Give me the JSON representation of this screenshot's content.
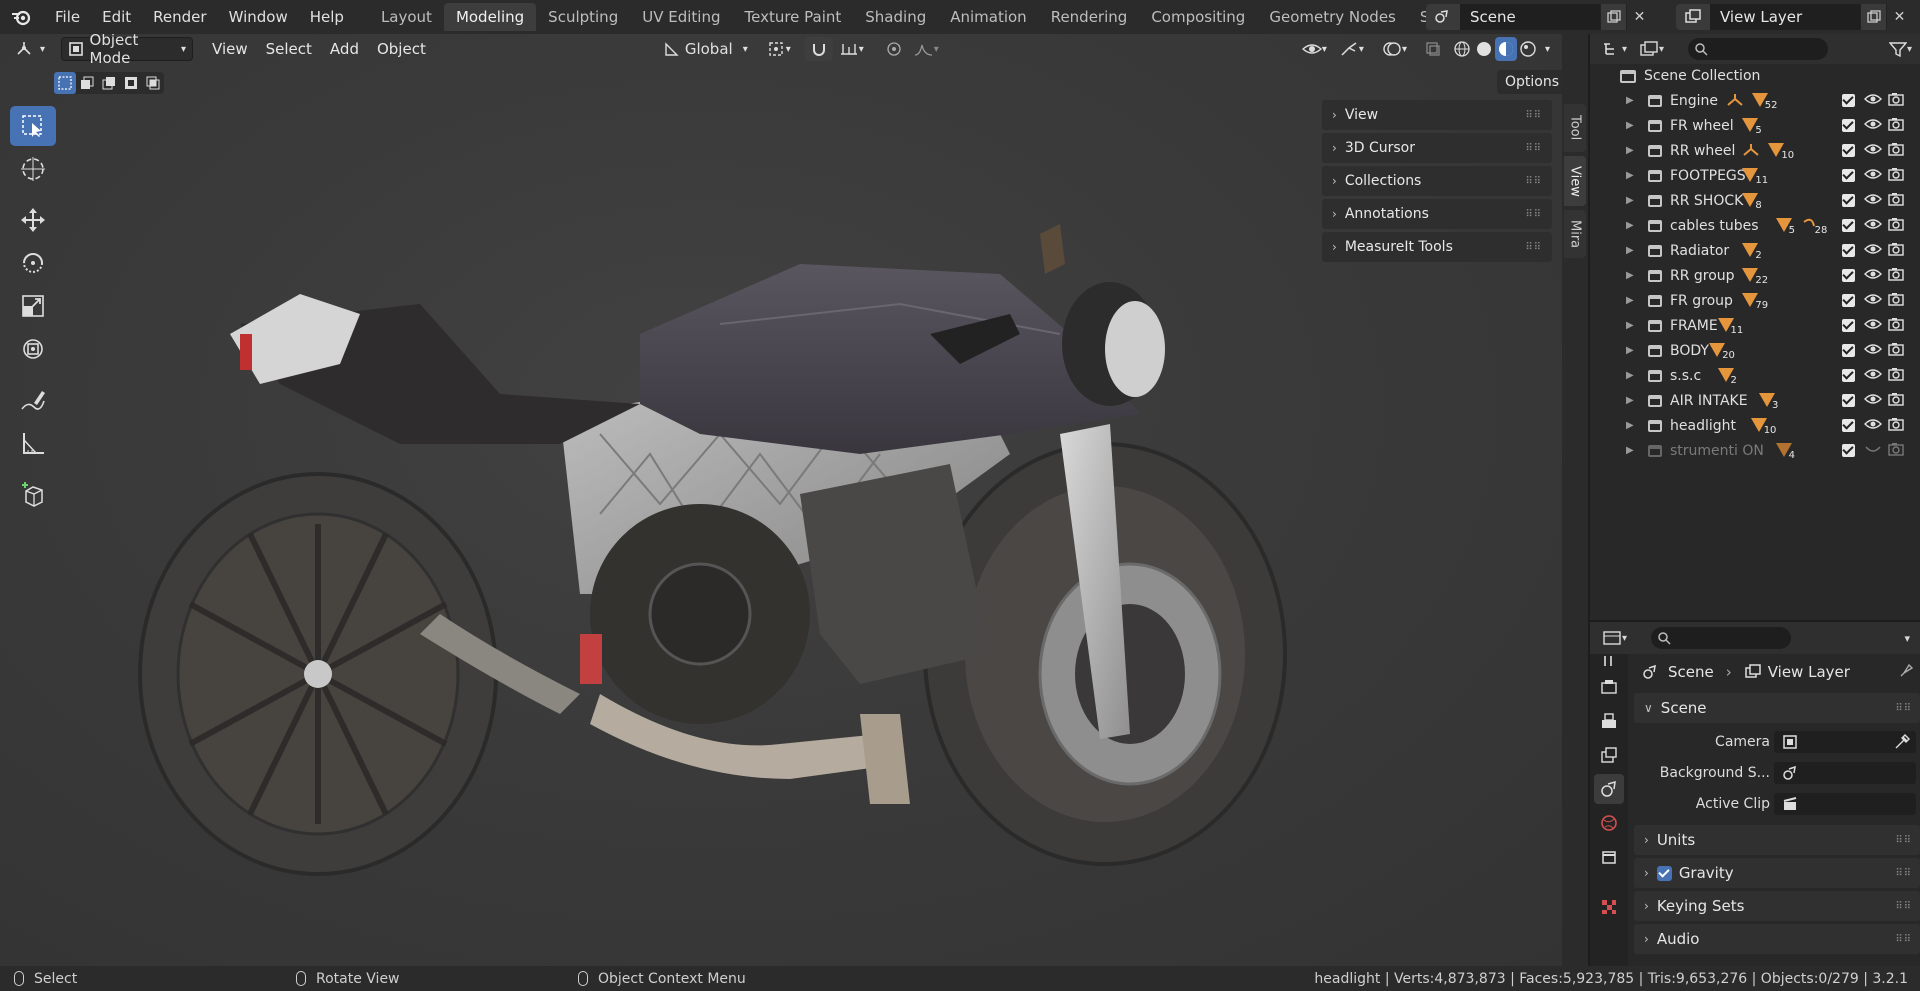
{
  "topbar": {
    "menus": [
      "File",
      "Edit",
      "Render",
      "Window",
      "Help"
    ],
    "workspaces": [
      "Layout",
      "Modeling",
      "Sculpting",
      "UV Editing",
      "Texture Paint",
      "Shading",
      "Animation",
      "Rendering",
      "Compositing",
      "Geometry Nodes",
      "Scripting"
    ],
    "active_workspace": "Modeling",
    "add_tab": "+",
    "scene": "Scene",
    "view_layer": "View Layer"
  },
  "viewport": {
    "mode": "Object Mode",
    "menus": [
      "View",
      "Select",
      "Add",
      "Object"
    ],
    "orientation": "Global",
    "options_label": "Options",
    "npanel_items": [
      "View",
      "3D Cursor",
      "Collections",
      "Annotations",
      "MeasureIt Tools"
    ],
    "side_tabs": [
      "Tool",
      "View",
      "Mira"
    ],
    "active_side_tab": "View"
  },
  "outliner": {
    "root": "Scene Collection",
    "collections": [
      {
        "name": "Engine",
        "badges": [
          {
            "type": "bone"
          },
          {
            "type": "mesh",
            "count": "52"
          }
        ],
        "disabled": false
      },
      {
        "name": "FR wheel",
        "badges": [
          {
            "type": "mesh",
            "count": "5"
          }
        ],
        "disabled": false
      },
      {
        "name": "RR wheel",
        "badges": [
          {
            "type": "bone"
          },
          {
            "type": "mesh",
            "count": "10"
          }
        ],
        "disabled": false
      },
      {
        "name": "FOOTPEGS",
        "badges": [
          {
            "type": "mesh",
            "count": "11"
          }
        ],
        "disabled": false
      },
      {
        "name": "RR SHOCK",
        "badges": [
          {
            "type": "mesh",
            "count": "8"
          }
        ],
        "disabled": false
      },
      {
        "name": "cables tubes",
        "badges": [
          {
            "type": "mesh",
            "count": "5"
          },
          {
            "type": "curve",
            "count": "28"
          }
        ],
        "disabled": false
      },
      {
        "name": "Radiator",
        "badges": [
          {
            "type": "mesh",
            "count": "2"
          }
        ],
        "disabled": false
      },
      {
        "name": "RR group",
        "badges": [
          {
            "type": "mesh",
            "count": "22"
          }
        ],
        "disabled": false
      },
      {
        "name": "FR group",
        "badges": [
          {
            "type": "mesh",
            "count": "79"
          }
        ],
        "disabled": false
      },
      {
        "name": "FRAME",
        "badges": [
          {
            "type": "mesh",
            "count": "11"
          }
        ],
        "disabled": false
      },
      {
        "name": "BODY",
        "badges": [
          {
            "type": "mesh",
            "count": "20"
          }
        ],
        "disabled": false
      },
      {
        "name": "s.s.c",
        "badges": [
          {
            "type": "mesh",
            "count": "2"
          }
        ],
        "disabled": false
      },
      {
        "name": "AIR INTAKE",
        "badges": [
          {
            "type": "mesh",
            "count": "3"
          }
        ],
        "disabled": false
      },
      {
        "name": "headlight",
        "badges": [
          {
            "type": "mesh",
            "count": "10"
          }
        ],
        "disabled": false
      },
      {
        "name": "strumenti ON",
        "badges": [
          {
            "type": "mesh",
            "count": "4"
          }
        ],
        "disabled": true
      }
    ]
  },
  "properties": {
    "breadcrumb": [
      "Scene",
      "View Layer"
    ],
    "scene_panel": "Scene",
    "fields": [
      {
        "label": "Camera"
      },
      {
        "label": "Background S..."
      },
      {
        "label": "Active Clip"
      }
    ],
    "panels": [
      "Units",
      "Gravity",
      "Keying Sets",
      "Audio"
    ]
  },
  "statusbar": {
    "select": "Select",
    "rotate": "Rotate View",
    "context": "Object Context Menu",
    "stats": "headlight | Verts:4,873,873 | Faces:5,923,785 | Tris:9,653,276 | Objects:0/279 | 3.2.1"
  },
  "colors": {
    "accent": "#4772b3",
    "mesh_badge": "#e5963d"
  }
}
